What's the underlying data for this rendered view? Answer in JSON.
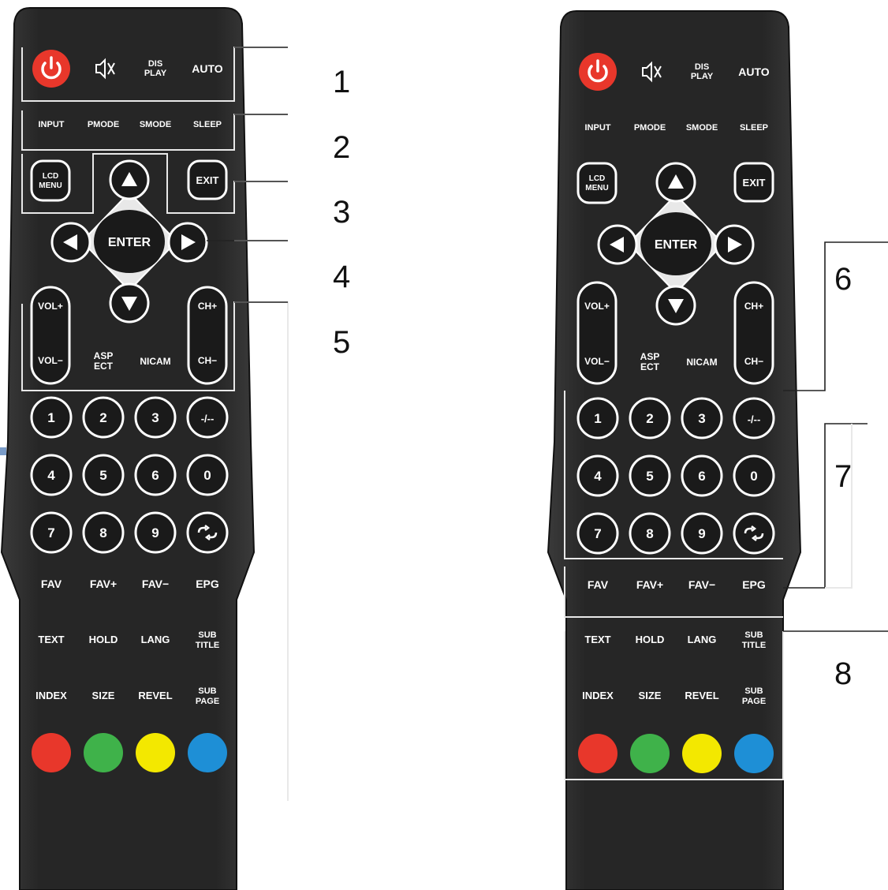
{
  "remote": {
    "top_row": [
      "DIS PLAY",
      "AUTO"
    ],
    "icons": [
      "power-icon",
      "mute-icon"
    ],
    "function_row": [
      "INPUT",
      "PMODE",
      "SMODE",
      "SLEEP"
    ],
    "lcd_menu": "LCD MENU",
    "exit": "EXIT",
    "enter": "ENTER",
    "vol_up": "VOL+",
    "vol_down": "VOL−",
    "ch_up": "CH+",
    "ch_down": "CH−",
    "aspect": "ASP ECT",
    "nicam": "NICAM",
    "digits": [
      "1",
      "2",
      "3",
      "-/--",
      "4",
      "5",
      "6",
      "0",
      "7",
      "8",
      "9",
      "recall-icon"
    ],
    "fav_row": [
      "FAV",
      "FAV+",
      "FAV−",
      "EPG"
    ],
    "text_row": [
      "TEXT",
      "HOLD",
      "LANG",
      "SUB TITLE"
    ],
    "index_row": [
      "INDEX",
      "SIZE",
      "REVEL",
      "SUB PAGE"
    ],
    "color_buttons": [
      "#e8372b",
      "#3fb24a",
      "#f3e800",
      "#1e8fd6"
    ],
    "power_color": "#e8372b",
    "body_color": "#262626"
  },
  "callouts": {
    "left": [
      "1",
      "2",
      "3",
      "4",
      "5"
    ],
    "right": [
      "6",
      "7",
      "8"
    ]
  }
}
